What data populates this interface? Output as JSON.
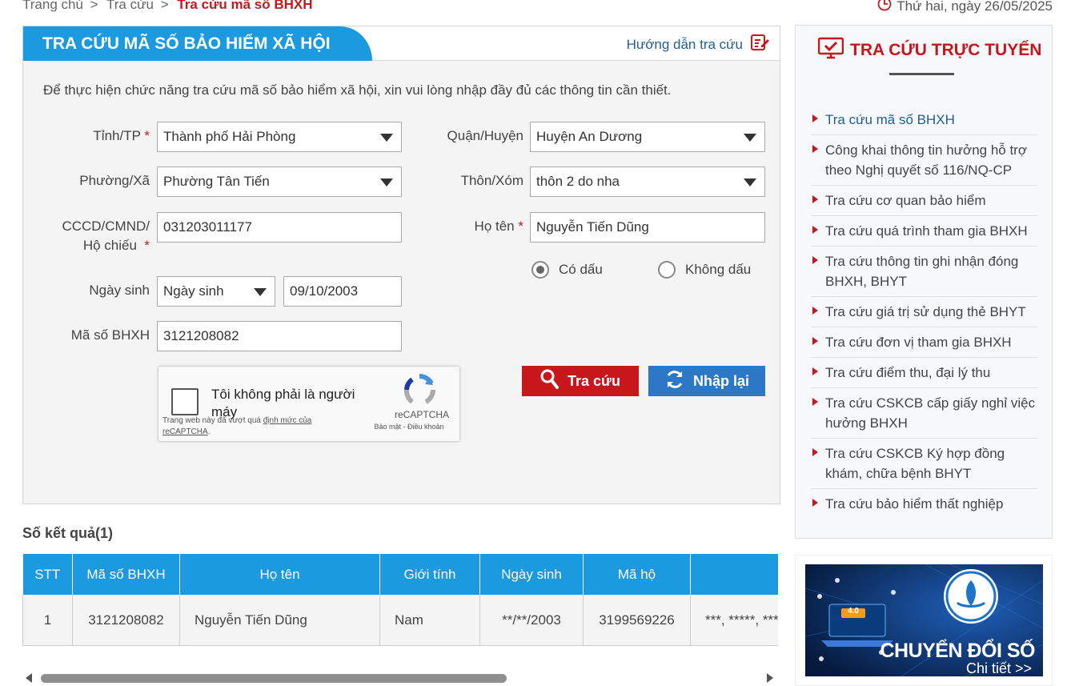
{
  "breadcrumb": {
    "home": "Trang chủ",
    "sep": ">",
    "level2": "Tra cứu",
    "current": "Tra cứu mã số BHXH"
  },
  "date": "Thứ hai, ngày 26/05/2025",
  "form": {
    "title": "TRA CỨU MÃ SỐ BẢO HIỂM XÃ HỘI",
    "guide": "Hướng dẫn tra cứu",
    "intro": "Để thực hiện chức năng tra cứu mã số bảo hiểm xã hội, xin vui lòng nhập đầy đủ các thông tin cần thiết.",
    "required_mark": "*",
    "province": {
      "label": "Tỉnh/TP",
      "value": "Thành phố Hải Phòng"
    },
    "district": {
      "label": "Quận/Huyện",
      "value": "Huyện An Dương"
    },
    "ward": {
      "label": "Phường/Xã",
      "value": "Phường Tân Tiến"
    },
    "village": {
      "label": "Thôn/Xóm",
      "value": "thôn 2 do nha"
    },
    "id_card": {
      "label_1": "CCCD/CMND/",
      "label_2": "Hộ chiếu",
      "value": "031203011177"
    },
    "fullname": {
      "label": "Họ tên",
      "value": "Nguyễn Tiến Dũng"
    },
    "accent": {
      "with": "Có dấu",
      "without": "Không dấu",
      "selected": "with"
    },
    "dob": {
      "label": "Ngày sinh",
      "type_value": "Ngày sinh",
      "value": "09/10/2003"
    },
    "bhxh_code": {
      "label": "Mã số BHXH",
      "value": "3121208082"
    },
    "search_button": "Tra cứu",
    "reset_button": "Nhập lại",
    "captcha": {
      "text": "Tôi không phải là người máy",
      "brand": "reCAPTCHA",
      "links": "Bảo mật - Điều khoản",
      "note_prefix": "Trang web này đã vượt quá",
      "note_link": "định mức của reCAPTCHA",
      "note_suffix": "."
    }
  },
  "results": {
    "title": "Số kết quả(1)",
    "columns": [
      "STT",
      "Mã số BHXH",
      "Họ tên",
      "Giới tính",
      "Ngày sinh",
      "Mã hộ",
      ""
    ],
    "rows": [
      [
        "1",
        "3121208082",
        "Nguyễn Tiến Dũng",
        "Nam",
        "**/**/2003",
        "3199569226",
        "***, *****, ***"
      ]
    ]
  },
  "sidebar": {
    "title": "TRA CỨU TRỰC TUYẾN",
    "items": [
      "Tra cứu mã số BHXH",
      "Công khai thông tin hưởng hỗ trợ theo Nghị quyết số 116/NQ-CP",
      "Tra cứu cơ quan bảo hiểm",
      "Tra cứu quá trình tham gia BHXH",
      "Tra cứu thông tin ghi nhận đóng BHXH, BHYT",
      "Tra cứu giá trị sử dụng thẻ BHYT",
      "Tra cứu đơn vị tham gia BHXH",
      "Tra cứu điểm thu, đại lý thu",
      "Tra cứu CSKCB cấp giấy nghỉ việc hưởng BHXH",
      "Tra cứu CSKCB Ký hợp đồng khám, chữa bệnh BHYT",
      "Tra cứu bảo hiểm thất nghiệp"
    ]
  },
  "banner": {
    "title": "CHUYỂN ĐỔI SỐ",
    "link": "Chi tiết >>",
    "badge": "4.0"
  },
  "colors": {
    "primary_blue": "#1b9ae0",
    "brand_red": "#c8161d",
    "reset_blue": "#2d78c6"
  }
}
